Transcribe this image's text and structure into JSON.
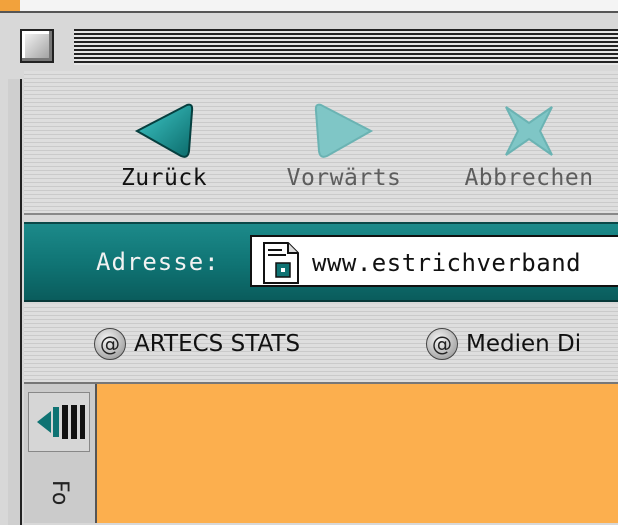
{
  "toolbar": {
    "back_label": "Zurück",
    "forward_label": "Vorwärts",
    "stop_label": "Abbrechen"
  },
  "address": {
    "label": "Adresse:",
    "url": "www.estrichverband"
  },
  "favorites": [
    {
      "label": "ARTECS STATS",
      "icon": "at-icon"
    },
    {
      "label": "Medien Di",
      "icon": "at-icon"
    }
  ],
  "sidebar": {
    "tab_label": "Fo"
  },
  "colors": {
    "accent_teal": "#0f7373",
    "content_orange": "#fcaf4e"
  }
}
